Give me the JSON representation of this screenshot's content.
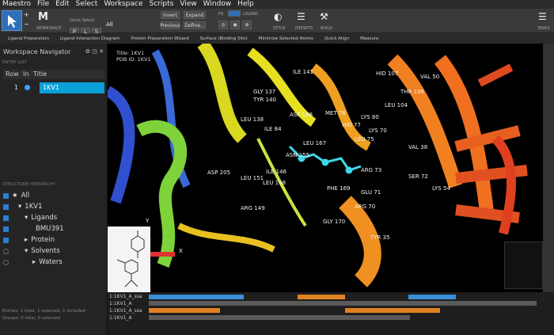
{
  "menu": [
    "Maestro",
    "File",
    "Edit",
    "Select",
    "Workspace",
    "Scripts",
    "View",
    "Window",
    "Help"
  ],
  "toolbar": {
    "quick_select_label": "Quick Select",
    "quick_select_buttons": [
      "P",
      "L",
      "S"
    ],
    "all_label": "All",
    "invert_label": "Invert",
    "expand_label": "Expand",
    "previous_label": "Previous",
    "define_label": "Define...",
    "workspace_label": "WORKSPACE",
    "ps_label": "PS",
    "ligand_label": "LIGAND",
    "style_label": "STYLE",
    "presets_label": "PRESETS",
    "build_label": "BUILD",
    "tasks_label": "TASKS"
  },
  "shortcuts": [
    "Ligand Preparation",
    "Ligand Interaction Diagram",
    "Protein Preparation Wizard",
    "Surface (Binding Site)",
    "Minimize Selected Atoms",
    "Quick Align",
    "Measure"
  ],
  "left": {
    "title": "Workspace Navigator",
    "entry_list_label": "ENTRY LIST",
    "columns": [
      "Row",
      "In",
      "Title"
    ],
    "row": {
      "num": "1",
      "title": "1KV1"
    },
    "structure_label": "STRUCTURE HIERARCHY",
    "tree": [
      "All",
      "1KV1",
      "Ligands",
      "BMU391",
      "Protein",
      "Solvents",
      "Waters"
    ],
    "status": [
      "Entries: 1 total, 1 selected, 1 included",
      "Groups: 0 total, 0 selected"
    ]
  },
  "viewport": {
    "title_line": "Title: 1KV1",
    "pdb_line": "PDB ID: 1KV1",
    "labels": [
      "HID 107",
      "ILE 141",
      "VAL 50",
      "GLY 137",
      "TYR 140",
      "LEU 167",
      "LYS 80",
      "LEU 138",
      "MET 78",
      "HID 77",
      "LYS 70",
      "LEU 75",
      "ILE 84",
      "ASP 168",
      "THR 106",
      "VAL 38",
      "ASP 205",
      "ILE 146",
      "LEU 151",
      "LEU 148",
      "ARG 73",
      "GLU 71",
      "PHE 169",
      "SER 72",
      "LYS 54",
      "ARG 149",
      "ARG 70",
      "GLY 170",
      "TYR 35",
      "LEU 104",
      "ASN 155"
    ],
    "axis_x": "X",
    "axis_y": "Y"
  },
  "sequence": {
    "rows": [
      "1:1KV1_A_ssa",
      "1:1KV1_A",
      "1:1KV1_A_ssa",
      "1:1KV1_A"
    ]
  }
}
